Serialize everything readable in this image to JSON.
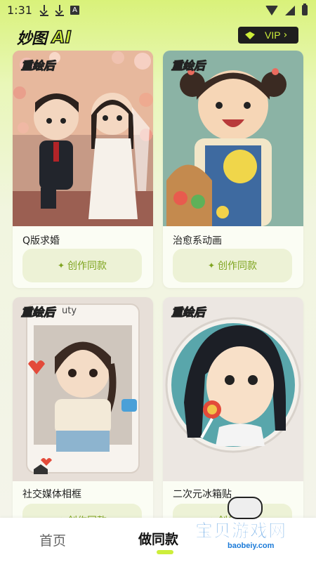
{
  "status_bar": {
    "time": "1:31",
    "notif_icon_letter": "A"
  },
  "header": {
    "logo_cn": "妙图",
    "logo_ai": "AI",
    "vip_label": "VIP",
    "vip_chevron": "›"
  },
  "cards": [
    {
      "tag": "重绘后",
      "title": "Q版求婚",
      "button": "创作同款",
      "icon": "sparkle-icon"
    },
    {
      "tag": "重绘后",
      "title": "治愈系动画",
      "button": "创作同款",
      "icon": "sparkle-icon"
    },
    {
      "tag": "重绘后",
      "title": "社交媒体相框",
      "button": "创作同款",
      "icon": "sparkle-icon",
      "frame_text": "uty"
    },
    {
      "tag": "重绘后",
      "title": "二次元冰箱贴",
      "button": "创作同款",
      "icon": "sparkle-icon"
    }
  ],
  "bottom_nav": {
    "home": "首页",
    "same_style": "做同款"
  },
  "watermark": {
    "text": "宝贝游戏网",
    "url": "baobeiy.com"
  },
  "colors": {
    "accent": "#cdee3a",
    "button_text": "#7ea41f",
    "button_bg": "#edf2d6"
  }
}
